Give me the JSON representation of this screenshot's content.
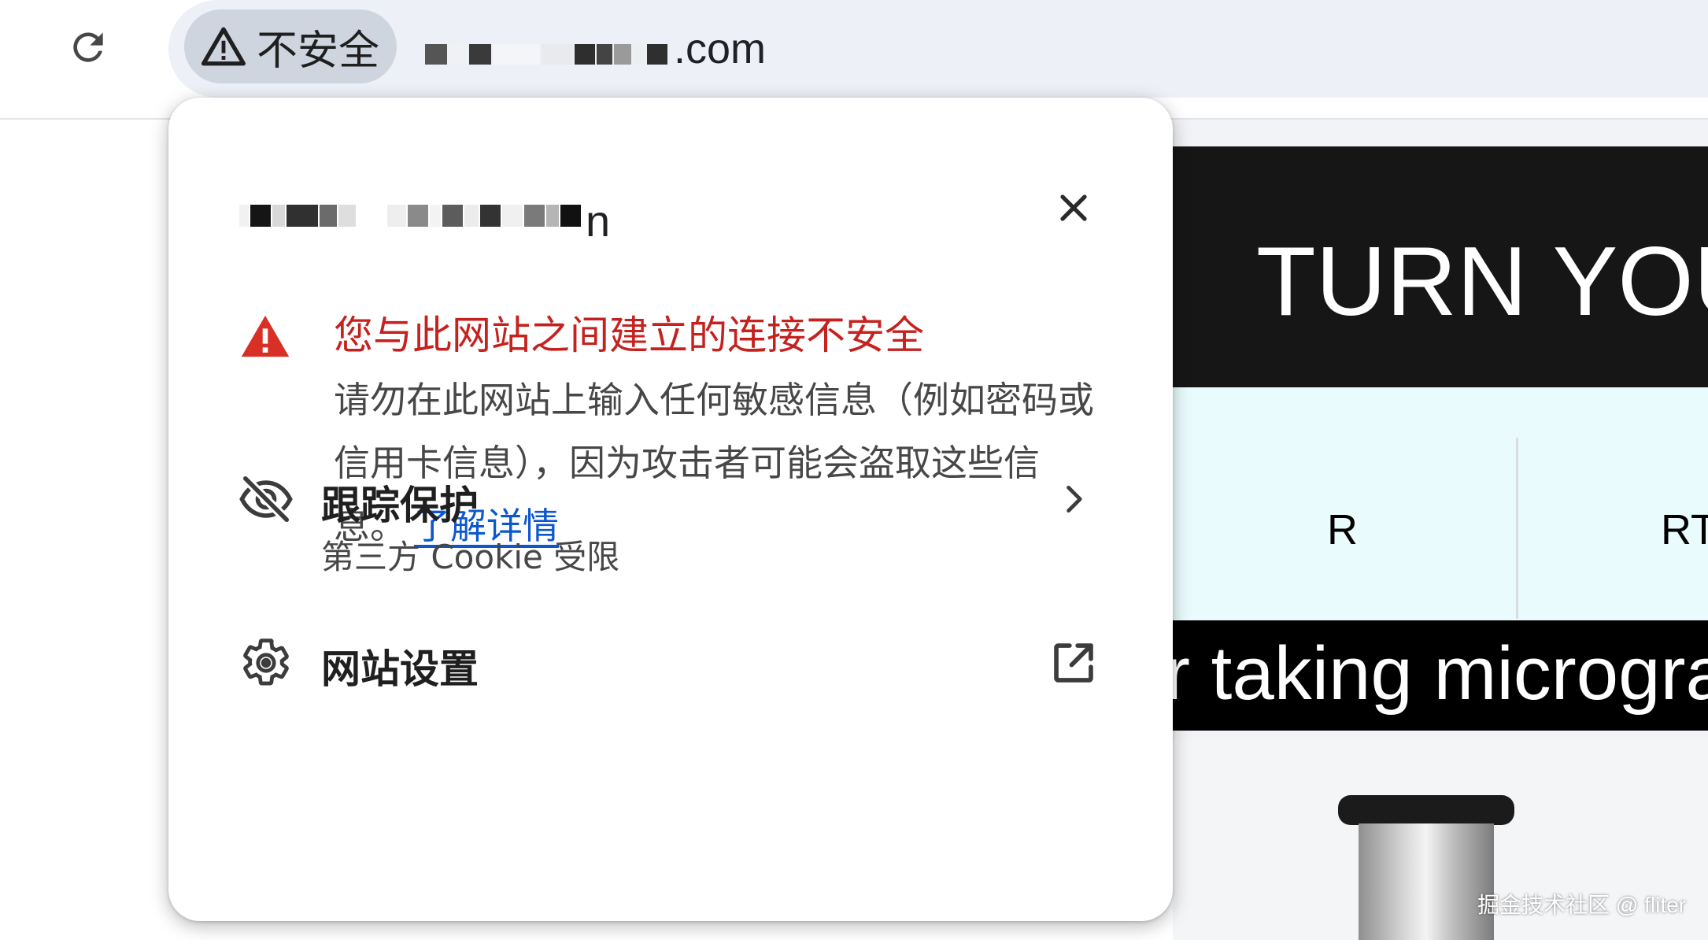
{
  "browser": {
    "reload_icon": "reload-icon",
    "security_chip": {
      "icon": "warning-triangle-icon",
      "label": "不安全"
    },
    "url_suffix": ".com"
  },
  "popup": {
    "site_suffix": "n",
    "close_icon": "close-icon",
    "warning": {
      "icon": "warning-triangle-red-icon",
      "title": "您与此网站之间建立的连接不安全",
      "body": "请勿在此网站上输入任何敏感信息（例如密码或信用卡信息），因为攻击者可能会盗取这些信息。",
      "learn_more": "了解详情",
      "title_color": "#c5221f",
      "link_color": "#0b57d0"
    },
    "tracking": {
      "icon": "eye-off-icon",
      "title": "跟踪保护",
      "subtitle": "第三方 Cookie 受限",
      "trailing_icon": "chevron-right-icon"
    },
    "site_settings": {
      "icon": "gear-icon",
      "title": "网站设置",
      "trailing_icon": "open-in-new-icon"
    }
  },
  "background_page": {
    "hero_title": "TURN YOU",
    "tabs": [
      "R",
      "RT"
    ],
    "marquee": "r taking microgra"
  },
  "watermark": "掘金技术社区 @ fliter"
}
